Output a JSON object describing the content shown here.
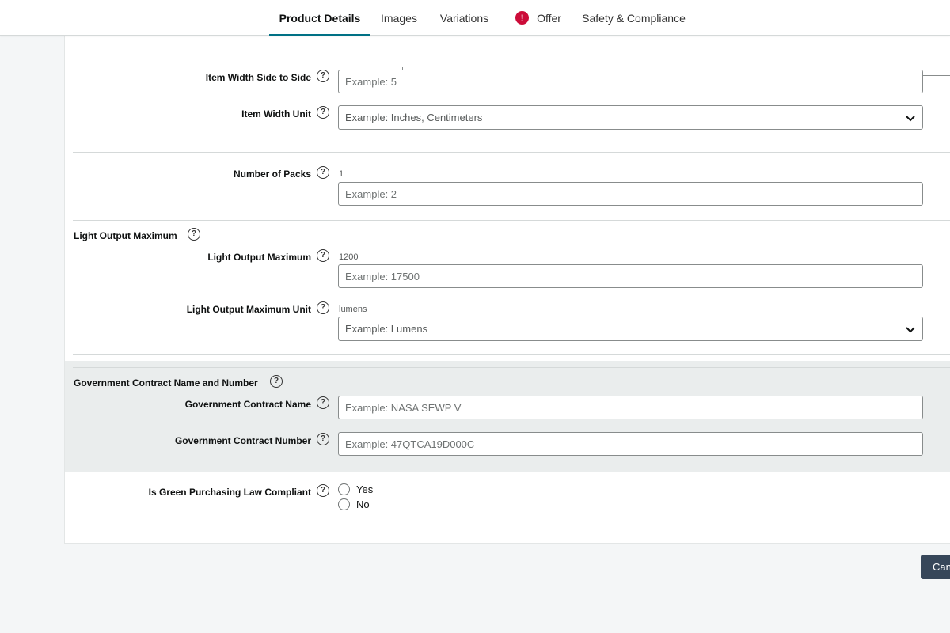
{
  "tabs": [
    {
      "label": "Product Details",
      "active": true
    },
    {
      "label": "Images",
      "active": false
    },
    {
      "label": "Variations",
      "active": false
    },
    {
      "label": "Offer",
      "active": false,
      "alert": true
    },
    {
      "label": "Safety & Compliance",
      "active": false
    }
  ],
  "fields": {
    "item_width": {
      "label": "Item Width Side to Side",
      "placeholder": "Example: 5"
    },
    "item_width_unit": {
      "label": "Item Width Unit",
      "placeholder": "Example: Inches, Centimeters"
    },
    "number_of_packs": {
      "label": "Number of Packs",
      "current": "1",
      "placeholder": "Example: 2"
    },
    "light_output_group": {
      "label": "Light Output Maximum"
    },
    "light_output_max": {
      "label": "Light Output Maximum",
      "current": "1200",
      "placeholder": "Example: 17500"
    },
    "light_output_unit": {
      "label": "Light Output Maximum Unit",
      "current": "lumens",
      "placeholder": "Example: Lumens"
    },
    "gov_group": {
      "label": "Government Contract Name and Number"
    },
    "gov_name": {
      "label": "Government Contract Name",
      "placeholder": "Example: NASA SEWP V"
    },
    "gov_number": {
      "label": "Government Contract Number",
      "placeholder": "Example: 47QTCA19D000C"
    },
    "green": {
      "label": "Is Green Purchasing Law Compliant",
      "options": [
        "Yes",
        "No"
      ]
    }
  },
  "help_glyph": "?",
  "alert_glyph": "!",
  "icons": {
    "help": "question-circle-icon",
    "alert": "alert-icon",
    "dropdown": "chevron-down-icon"
  },
  "buttons": {
    "cancel": "Can"
  },
  "colors": {
    "accent": "#007185",
    "alert": "#cc0c39",
    "cancel_bg": "#37475a"
  }
}
